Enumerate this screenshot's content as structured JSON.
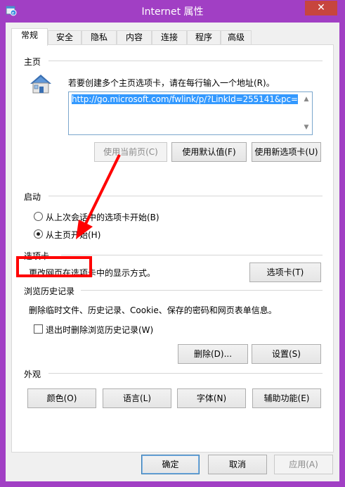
{
  "window": {
    "title": "Internet 属性",
    "close_label": "✕",
    "app_icon": "ie-options-icon"
  },
  "tabs": [
    {
      "label": "常规",
      "active": true
    },
    {
      "label": "安全"
    },
    {
      "label": "隐私"
    },
    {
      "label": "内容"
    },
    {
      "label": "连接"
    },
    {
      "label": "程序"
    },
    {
      "label": "高级"
    }
  ],
  "homepage": {
    "title": "主页",
    "description": "若要创建多个主页选项卡，请在每行输入一个地址(R)。",
    "url": "http://go.microsoft.com/fwlink/p/?LinkId=255141&pc=",
    "use_current_label": "使用当前页(C)",
    "use_default_label": "使用默认值(F)",
    "use_new_tab_label": "使用新选项卡(U)",
    "icon": "house-icon"
  },
  "startup": {
    "title": "启动",
    "option_last_session": "从上次会话中的选项卡开始(B)",
    "option_homepage": "从主页开始(H)",
    "selected": "homepage"
  },
  "tabs_section": {
    "title": "选项卡",
    "description": "更改网页在选项卡中的显示方式。",
    "button_label": "选项卡(T)"
  },
  "history": {
    "title": "浏览历史记录",
    "description": "删除临时文件、历史记录、Cookie、保存的密码和网页表单信息。",
    "delete_on_exit_label": "退出时删除浏览历史记录(W)",
    "delete_on_exit_checked": false,
    "delete_label": "删除(D)...",
    "settings_label": "设置(S)"
  },
  "appearance": {
    "title": "外观",
    "colors_label": "颜色(O)",
    "languages_label": "语言(L)",
    "fonts_label": "字体(N)",
    "accessibility_label": "辅助功能(E)"
  },
  "footer": {
    "ok_label": "确定",
    "cancel_label": "取消",
    "apply_label": "应用(A)"
  },
  "annotation": {
    "highlight_color": "#ff0000"
  }
}
